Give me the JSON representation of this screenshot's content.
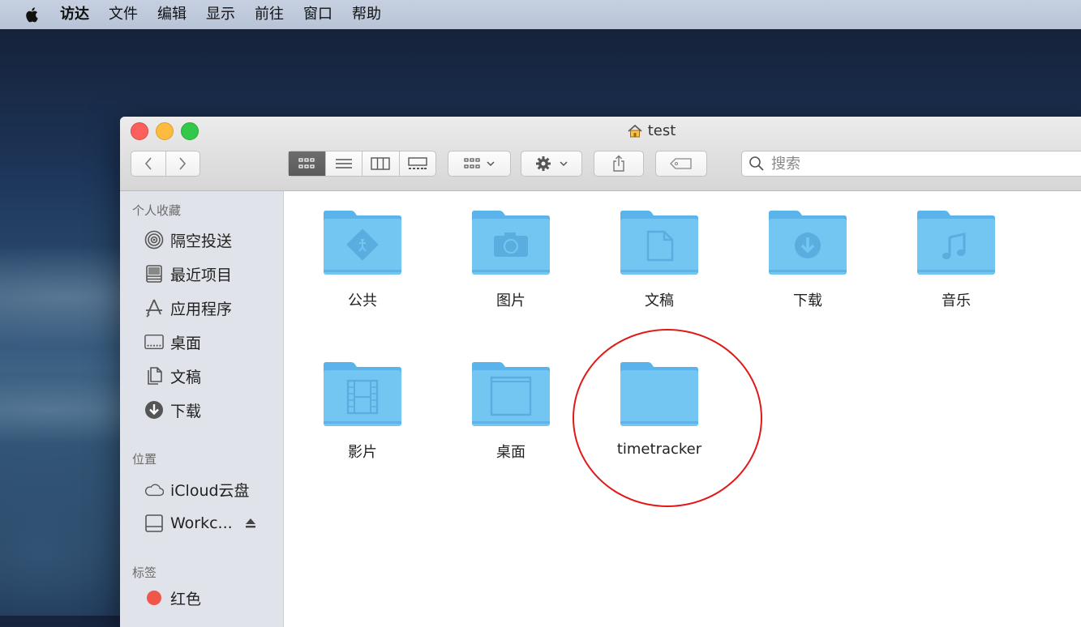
{
  "menubar": {
    "items": [
      "访达",
      "文件",
      "编辑",
      "显示",
      "前往",
      "窗口",
      "帮助"
    ]
  },
  "window": {
    "title": "test",
    "search_placeholder": "搜索"
  },
  "sidebar": {
    "favorites_header": "个人收藏",
    "favorites": [
      {
        "label": "隔空投送",
        "icon": "airdrop-icon"
      },
      {
        "label": "最近项目",
        "icon": "recents-icon"
      },
      {
        "label": "应用程序",
        "icon": "applications-icon"
      },
      {
        "label": "桌面",
        "icon": "desktop-icon"
      },
      {
        "label": "文稿",
        "icon": "documents-icon"
      },
      {
        "label": "下载",
        "icon": "downloads-icon"
      }
    ],
    "locations_header": "位置",
    "locations": [
      {
        "label": "iCloud云盘",
        "icon": "icloud-icon"
      },
      {
        "label": "Workc...",
        "icon": "disk-icon"
      }
    ],
    "tags_header": "标签",
    "tags": [
      {
        "label": "红色",
        "color": "#f0574a"
      }
    ]
  },
  "content": {
    "folders": [
      {
        "label": "公共",
        "glyph": "public-icon"
      },
      {
        "label": "图片",
        "glyph": "camera-icon"
      },
      {
        "label": "文稿",
        "glyph": "document-icon"
      },
      {
        "label": "下载",
        "glyph": "download-icon"
      },
      {
        "label": "音乐",
        "glyph": "music-icon"
      },
      {
        "label": "影片",
        "glyph": "film-icon"
      },
      {
        "label": "桌面",
        "glyph": "desktop-window-icon"
      },
      {
        "label": "timetracker",
        "glyph": "none"
      }
    ]
  },
  "colors": {
    "folder": "#70c4f2",
    "annotation_circle": "#e01919"
  }
}
